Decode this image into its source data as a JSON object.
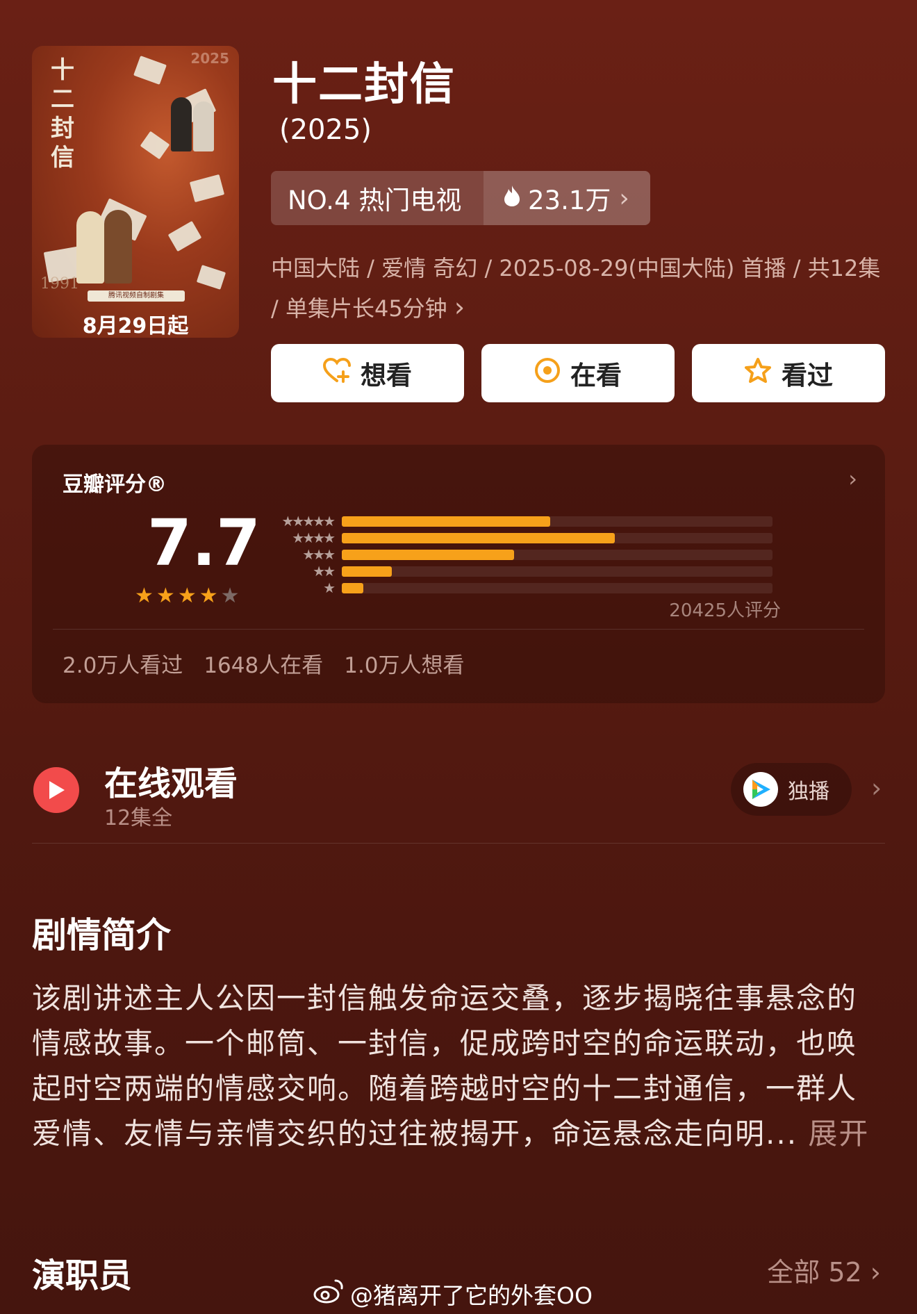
{
  "show": {
    "title": "十二封信",
    "year": "(2025)",
    "rank_label": "NO.4 热门电视",
    "heat_label": "23.1万",
    "meta": "中国大陆 / 爱情 奇幻 / 2025-08-29(中国大陆) 首播 / 共12集 / 单集片长45分钟"
  },
  "poster": {
    "title_vertical": "十二封信",
    "tag": "腾讯视频自制剧集",
    "date": "8月29日起",
    "year_mark": "1991",
    "stamp_year": "2025"
  },
  "actions": {
    "want_label": "想看",
    "watching_label": "在看",
    "watched_label": "看过"
  },
  "rating": {
    "label": "豆瓣评分®",
    "score": "7.7",
    "score_stars": 4,
    "distribution": [
      0.29,
      0.38,
      0.24,
      0.07,
      0.03
    ],
    "count_label": "20425人评分",
    "stats": [
      "2.0万人看过",
      "1648人在看",
      "1.0万人想看"
    ]
  },
  "online": {
    "title": "在线观看",
    "subtitle": "12集全",
    "exclusive_label": "独播"
  },
  "synopsis": {
    "heading": "剧情简介",
    "text": "该剧讲述主人公因一封信触发命运交叠，逐步揭晓往事悬念的情感故事。一个邮筒、一封信，促成跨时空的命运联动，也唤起时空两端的情感交响。随着跨越时空的十二封通信，一群人爱情、友情与亲情交织的过往被揭开，命运悬念走向明...",
    "more_label": "展开"
  },
  "cast": {
    "heading": "演职员",
    "all_label": "全部 52"
  },
  "watermark": "@猪离开了它的外套OO",
  "colors": {
    "accent_orange": "#f7a11a",
    "play_red": "#f24b4b",
    "background": "#5b1c12"
  }
}
